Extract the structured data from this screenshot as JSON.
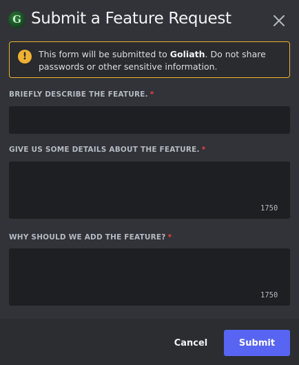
{
  "header": {
    "title": "Submit a Feature Request",
    "server_icon_letter": "G"
  },
  "notice": {
    "text_before": "This form will be submitted to ",
    "server_name": "Goliath",
    "text_after": ". Do not share passwords or other sensitive information.",
    "icon": "warning-icon"
  },
  "fields": [
    {
      "label": "BRIEFLY DESCRIBE THE FEATURE.",
      "required_marker": "*",
      "value": ""
    },
    {
      "label": "GIVE US SOME DETAILS ABOUT THE FEATURE.",
      "required_marker": "*",
      "value": "",
      "counter": "1750"
    },
    {
      "label": "WHY SHOULD WE ADD THE FEATURE?",
      "required_marker": "*",
      "value": "",
      "counter": "1750"
    }
  ],
  "footer": {
    "cancel_label": "Cancel",
    "submit_label": "Submit"
  },
  "colors": {
    "accent": "#5865f2",
    "warning": "#f0b232",
    "required": "#f23f43"
  }
}
